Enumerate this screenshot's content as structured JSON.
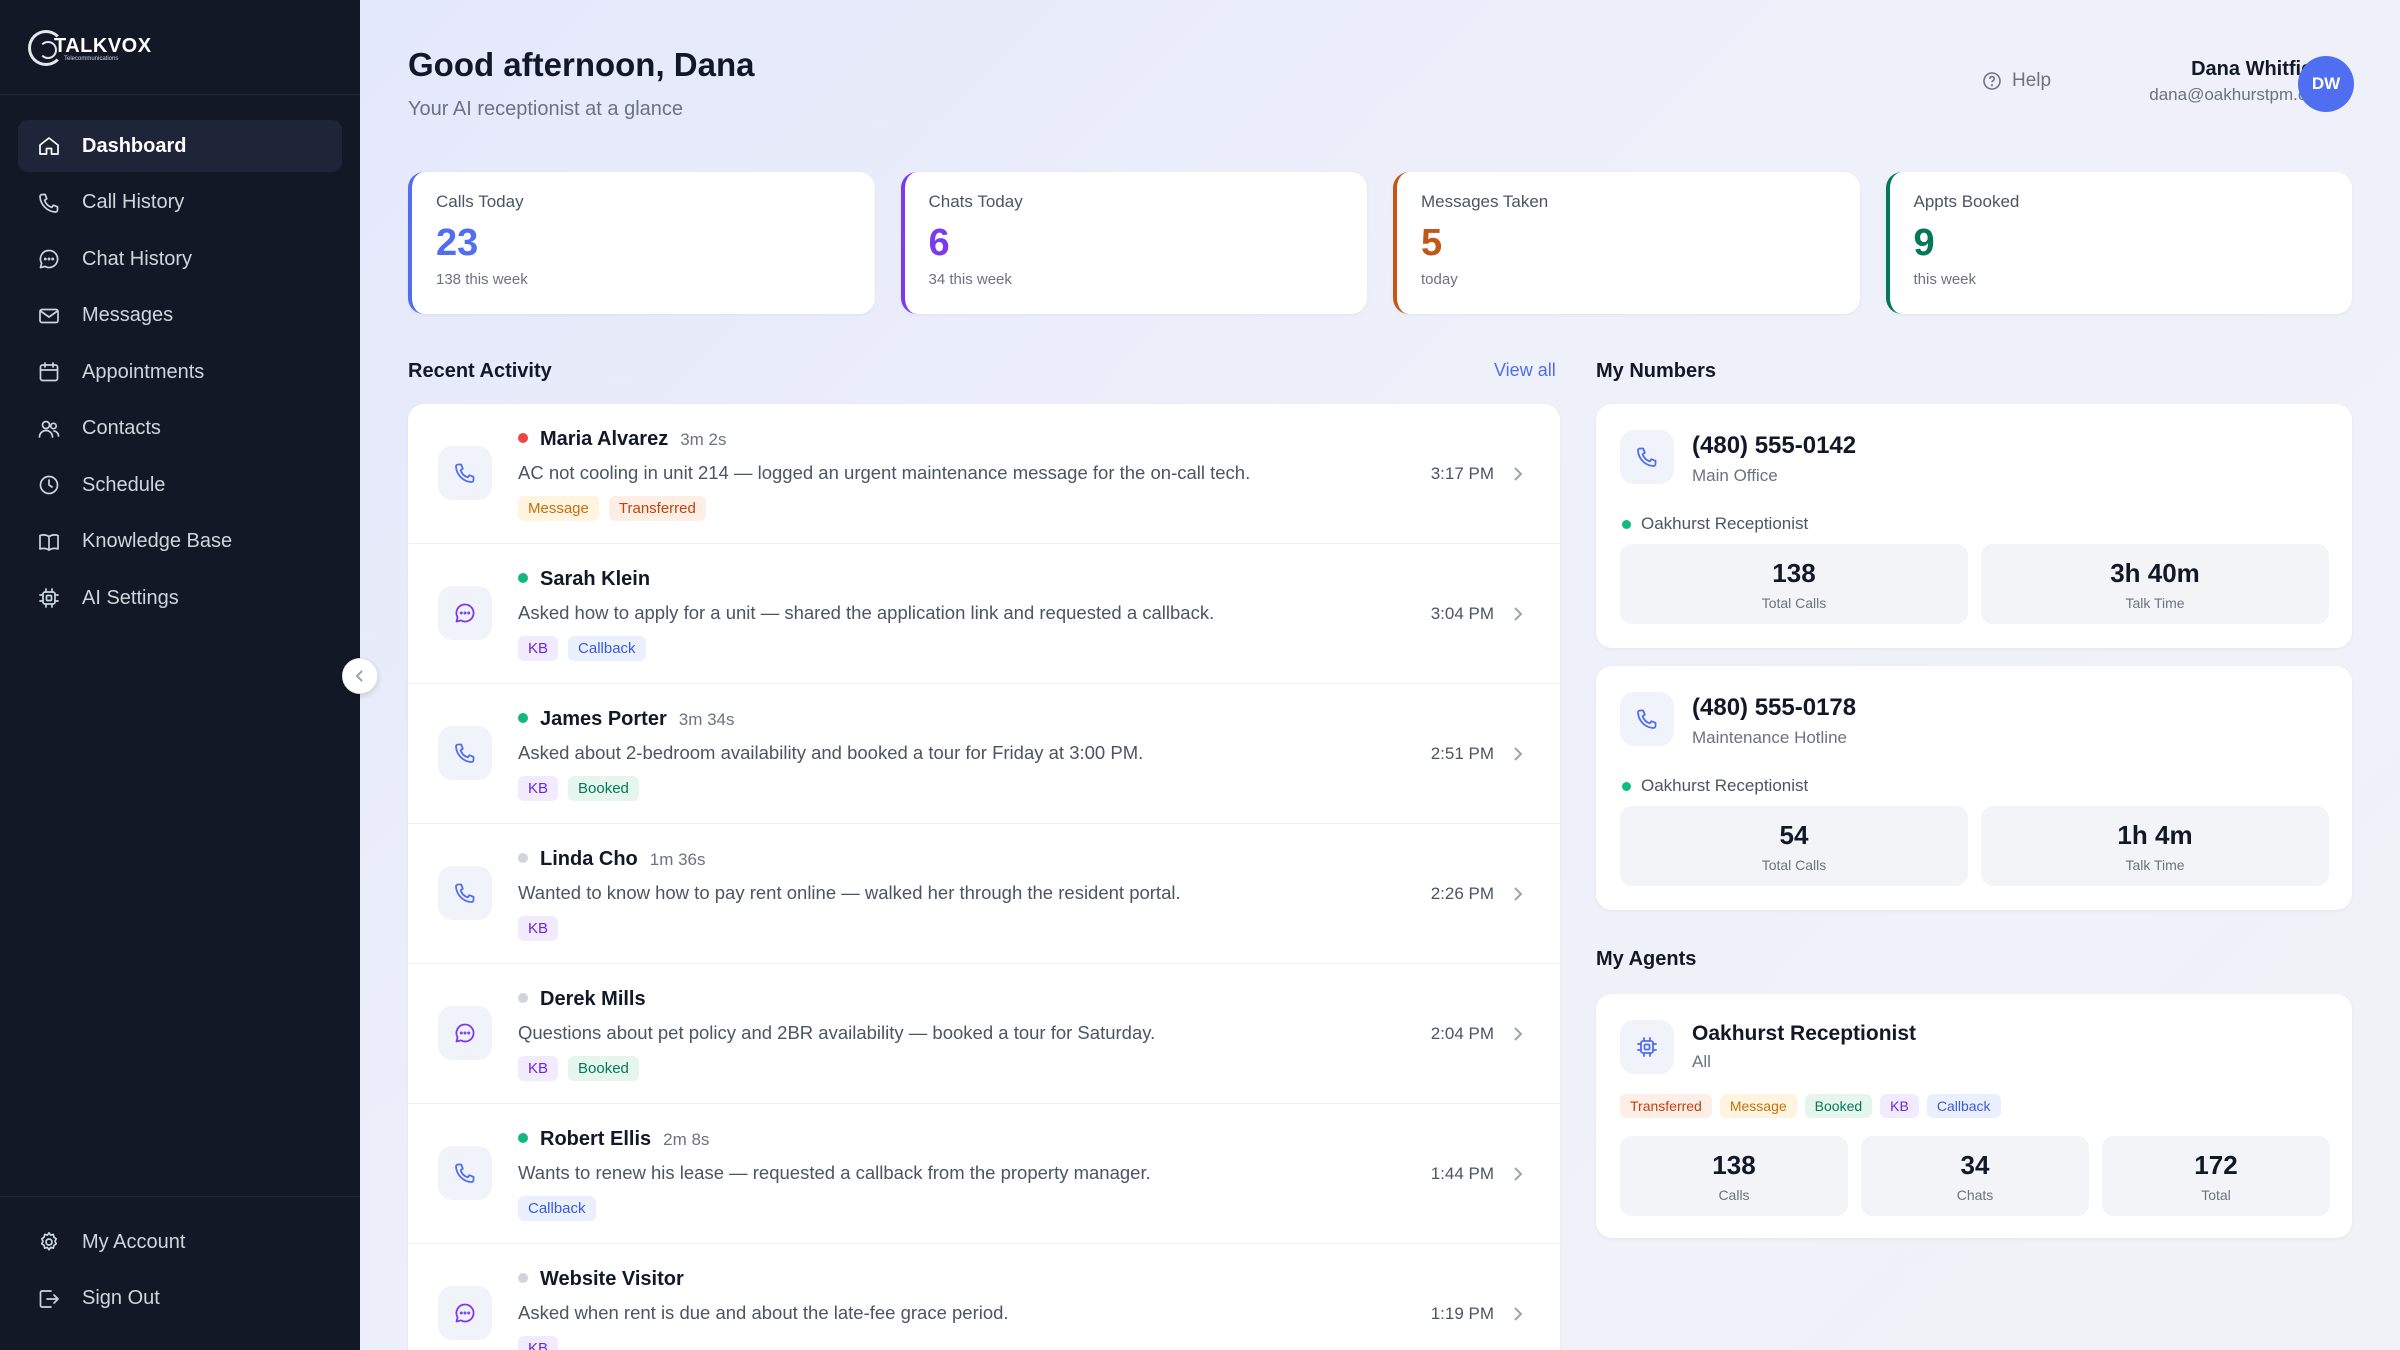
{
  "brand": {
    "name": "TALKVOX",
    "sub": "Telecommunications"
  },
  "nav": [
    {
      "label": "Dashboard",
      "icon": "home-icon",
      "active": true
    },
    {
      "label": "Call History",
      "icon": "phone-icon"
    },
    {
      "label": "Chat History",
      "icon": "chat-icon"
    },
    {
      "label": "Messages",
      "icon": "mail-icon"
    },
    {
      "label": "Appointments",
      "icon": "calendar-icon"
    },
    {
      "label": "Contacts",
      "icon": "users-icon"
    },
    {
      "label": "Schedule",
      "icon": "clock-icon"
    },
    {
      "label": "Knowledge Base",
      "icon": "book-icon"
    },
    {
      "label": "AI Settings",
      "icon": "chip-icon"
    }
  ],
  "nav_bottom": [
    {
      "label": "My Account",
      "icon": "gear-icon"
    },
    {
      "label": "Sign Out",
      "icon": "signout-icon"
    }
  ],
  "header": {
    "greeting": "Good afternoon, Dana",
    "subtitle": "Your AI receptionist at a glance",
    "help": "Help",
    "user_name": "Dana Whitfield",
    "user_email": "dana@oakhurstpm.com",
    "avatar_initials": "DW"
  },
  "stats": [
    {
      "label": "Calls Today",
      "value": "23",
      "sub": "138 this week",
      "color": "#4f6ef0"
    },
    {
      "label": "Chats Today",
      "value": "6",
      "sub": "34 this week",
      "color": "#7c3aed"
    },
    {
      "label": "Messages Taken",
      "value": "5",
      "sub": "today",
      "color": "#c2571a"
    },
    {
      "label": "Appts Booked",
      "value": "9",
      "sub": "this week",
      "color": "#047857"
    }
  ],
  "activity": {
    "title": "Recent Activity",
    "view_all": "View all",
    "items": [
      {
        "type": "call",
        "status": "#ef4444",
        "name": "Maria Alvarez",
        "duration": "3m 2s",
        "desc": "AC not cooling in unit 214 — logged an urgent maintenance message for the on-call tech.",
        "tags": [
          "Message",
          "Transferred"
        ],
        "time": "3:17 PM"
      },
      {
        "type": "chat",
        "status": "#10b981",
        "name": "Sarah Klein",
        "duration": "",
        "desc": "Asked how to apply for a unit — shared the application link and requested a callback.",
        "tags": [
          "KB",
          "Callback"
        ],
        "time": "3:04 PM"
      },
      {
        "type": "call",
        "status": "#10b981",
        "name": "James Porter",
        "duration": "3m 34s",
        "desc": "Asked about 2-bedroom availability and booked a tour for Friday at 3:00 PM.",
        "tags": [
          "KB",
          "Booked"
        ],
        "time": "2:51 PM"
      },
      {
        "type": "call",
        "status": "#d1d5db",
        "name": "Linda Cho",
        "duration": "1m 36s",
        "desc": "Wanted to know how to pay rent online — walked her through the resident portal.",
        "tags": [
          "KB"
        ],
        "time": "2:26 PM"
      },
      {
        "type": "chat",
        "status": "#d1d5db",
        "name": "Derek Mills",
        "duration": "",
        "desc": "Questions about pet policy and 2BR availability — booked a tour for Saturday.",
        "tags": [
          "KB",
          "Booked"
        ],
        "time": "2:04 PM"
      },
      {
        "type": "call",
        "status": "#10b981",
        "name": "Robert Ellis",
        "duration": "2m 8s",
        "desc": "Wants to renew his lease — requested a callback from the property manager.",
        "tags": [
          "Callback"
        ],
        "time": "1:44 PM"
      },
      {
        "type": "chat",
        "status": "#d1d5db",
        "name": "Website Visitor",
        "duration": "",
        "desc": "Asked when rent is due and about the late-fee grace period.",
        "tags": [
          "KB"
        ],
        "time": "1:19 PM"
      }
    ]
  },
  "tag_colors": {
    "Message": {
      "bg": "#fff4e0",
      "fg": "#c2710c"
    },
    "Transferred": {
      "bg": "#fdeee6",
      "fg": "#c2410c"
    },
    "KB": {
      "bg": "#f1ebfd",
      "fg": "#6d28d9"
    },
    "Callback": {
      "bg": "#eaf0fe",
      "fg": "#3b5bdb"
    },
    "Booked": {
      "bg": "#e6f6ee",
      "fg": "#047857"
    }
  },
  "numbers": {
    "title": "My Numbers",
    "items": [
      {
        "phone": "(480) 555-0142",
        "label": "Main Office",
        "agent": "Oakhurst Receptionist",
        "total_calls": "138",
        "total_calls_label": "Total Calls",
        "talk_time": "3h 40m",
        "talk_time_label": "Talk Time"
      },
      {
        "phone": "(480) 555-0178",
        "label": "Maintenance Hotline",
        "agent": "Oakhurst Receptionist",
        "total_calls": "54",
        "total_calls_label": "Total Calls",
        "talk_time": "1h 4m",
        "talk_time_label": "Talk Time"
      }
    ]
  },
  "agents": {
    "title": "My Agents",
    "name": "Oakhurst Receptionist",
    "scope": "All",
    "tags": [
      "Transferred",
      "Message",
      "Booked",
      "KB",
      "Callback"
    ],
    "metrics": [
      {
        "value": "138",
        "label": "Calls"
      },
      {
        "value": "34",
        "label": "Chats"
      },
      {
        "value": "172",
        "label": "Total"
      }
    ]
  }
}
